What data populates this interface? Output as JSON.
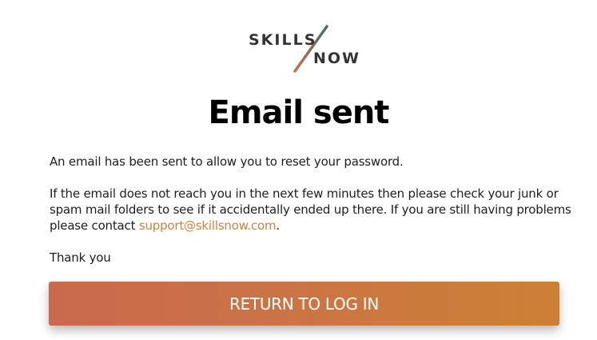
{
  "brand": {
    "word1": "SKILLS",
    "word2": "NOW",
    "slash_colors": [
      "#4a6b6c",
      "#c4714f"
    ]
  },
  "heading": "Email sent",
  "message": {
    "line1": "An email has been sent to allow you to reset your password.",
    "line2_text": "If the email does not reach you in the next few minutes then please check your junk or spam mail folders to see if it accidentally ended up there. If you are still having problems please contact ",
    "support_email": "support@skillsnow.com",
    "line2_end": ".",
    "thanks": "Thank you"
  },
  "button": {
    "label": "RETURN TO LOG IN"
  },
  "colors": {
    "accent_link": "#c9823f",
    "button_start": "#c96a4e",
    "button_end": "#cd8034"
  }
}
